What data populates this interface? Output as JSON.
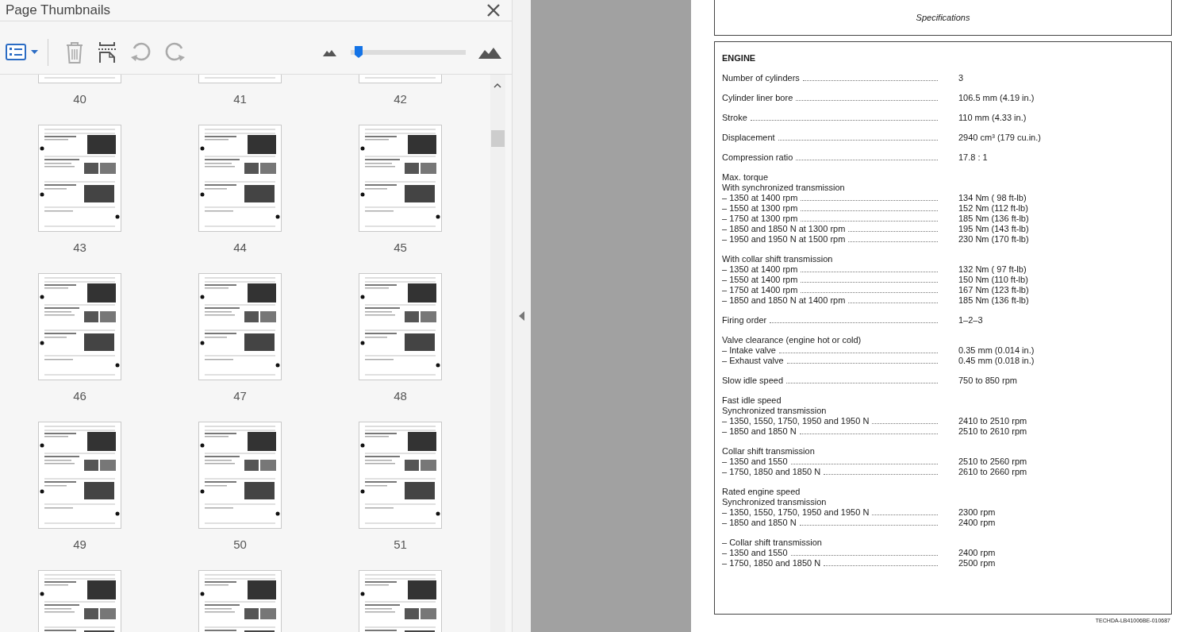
{
  "panel": {
    "title": "Page Thumbnails",
    "zoom_slider": {
      "level": 0.03
    }
  },
  "thumbnails": [
    {
      "label": "40",
      "kind": "cut-top"
    },
    {
      "label": "41",
      "kind": "cut-top"
    },
    {
      "label": "42",
      "kind": "cut-top"
    },
    {
      "label": "43",
      "kind": "full"
    },
    {
      "label": "44",
      "kind": "full"
    },
    {
      "label": "45",
      "kind": "full"
    },
    {
      "label": "46",
      "kind": "full"
    },
    {
      "label": "47",
      "kind": "full"
    },
    {
      "label": "48",
      "kind": "full"
    },
    {
      "label": "49",
      "kind": "full"
    },
    {
      "label": "50",
      "kind": "full"
    },
    {
      "label": "51",
      "kind": "full"
    },
    {
      "kind": "cut-bottom"
    },
    {
      "kind": "cut-bottom"
    },
    {
      "kind": "cut-bottom"
    }
  ],
  "document": {
    "header": "Specifications",
    "footer": "TECHDA-LB41006BE-010687",
    "blocks": [
      {
        "kind": "title",
        "text": "ENGINE"
      },
      {
        "kind": "spec",
        "label": "Number of cylinders",
        "value": "3"
      },
      {
        "kind": "spec",
        "label": "Cylinder liner bore",
        "value": "106.5 mm (4.19 in.)"
      },
      {
        "kind": "spec",
        "label": "Stroke",
        "value": "110 mm (4.33 in.)"
      },
      {
        "kind": "spec",
        "label": "Displacement",
        "value": "2940 cm³ (179 cu.in.)"
      },
      {
        "kind": "spec",
        "label": "Compression ratio",
        "value": "17.8 : 1"
      },
      {
        "kind": "group",
        "headings": [
          "Max. torque",
          "With synchronized transmission"
        ],
        "rows": [
          {
            "label": "– 1350 at 1400 rpm",
            "value": "134 Nm ( 98 ft-lb)"
          },
          {
            "label": "– 1550 at 1300 rpm",
            "value": "152 Nm (112 ft-lb)"
          },
          {
            "label": "– 1750 at 1300 rpm",
            "value": "185 Nm (136 ft-lb)"
          },
          {
            "label": "– 1850 and 1850 N at 1300 rpm",
            "value": "195 Nm (143 ft-lb)"
          },
          {
            "label": "– 1950 and 1950 N at 1500 rpm",
            "value": "230 Nm (170 ft-lb)"
          }
        ]
      },
      {
        "kind": "group",
        "headings": [
          "With collar shift transmission"
        ],
        "rows": [
          {
            "label": "– 1350 at 1400 rpm",
            "value": "132 Nm ( 97 ft-lb)"
          },
          {
            "label": "– 1550 at 1400 rpm",
            "value": "150 Nm (110 ft-lb)"
          },
          {
            "label": "– 1750 at 1400 rpm",
            "value": "167 Nm (123 ft-lb)"
          },
          {
            "label": "– 1850 and 1850 N at 1400 rpm",
            "value": "185 Nm (136 ft-lb)"
          }
        ]
      },
      {
        "kind": "spec",
        "label": "Firing order",
        "value": "1–2–3"
      },
      {
        "kind": "group",
        "headings": [
          "Valve clearance (engine hot or cold)"
        ],
        "rows": [
          {
            "label": "– Intake valve",
            "value": "0.35 mm (0.014 in.)"
          },
          {
            "label": "– Exhaust valve",
            "value": "0.45 mm (0.018 in.)"
          }
        ]
      },
      {
        "kind": "spec",
        "label": "Slow idle speed",
        "value": "750 to 850 rpm"
      },
      {
        "kind": "group",
        "headings": [
          "Fast idle speed",
          "Synchronized transmission"
        ],
        "rows": [
          {
            "label": "– 1350, 1550, 1750, 1950 and 1950 N",
            "value": "2410 to 2510 rpm"
          },
          {
            "label": "– 1850 and 1850 N",
            "value": "2510 to 2610 rpm"
          }
        ]
      },
      {
        "kind": "group",
        "headings": [
          "Collar shift transmission"
        ],
        "rows": [
          {
            "label": "– 1350 and 1550",
            "value": "2510 to 2560 rpm"
          },
          {
            "label": "– 1750, 1850 and 1850 N",
            "value": "2610 to 2660 rpm"
          }
        ]
      },
      {
        "kind": "group",
        "headings": [
          "Rated engine speed",
          "Synchronized transmission"
        ],
        "rows": [
          {
            "label": "– 1350, 1550, 1750, 1950 and 1950 N",
            "value": "2300 rpm"
          },
          {
            "label": "– 1850 and 1850 N",
            "value": "2400 rpm"
          }
        ]
      },
      {
        "kind": "group",
        "headings": [
          "– Collar shift transmission"
        ],
        "rows": [
          {
            "label": "– 1350 and 1550",
            "value": "2400 rpm"
          },
          {
            "label": "– 1750, 1850 and 1850 N",
            "value": "2500 rpm"
          }
        ]
      }
    ]
  }
}
